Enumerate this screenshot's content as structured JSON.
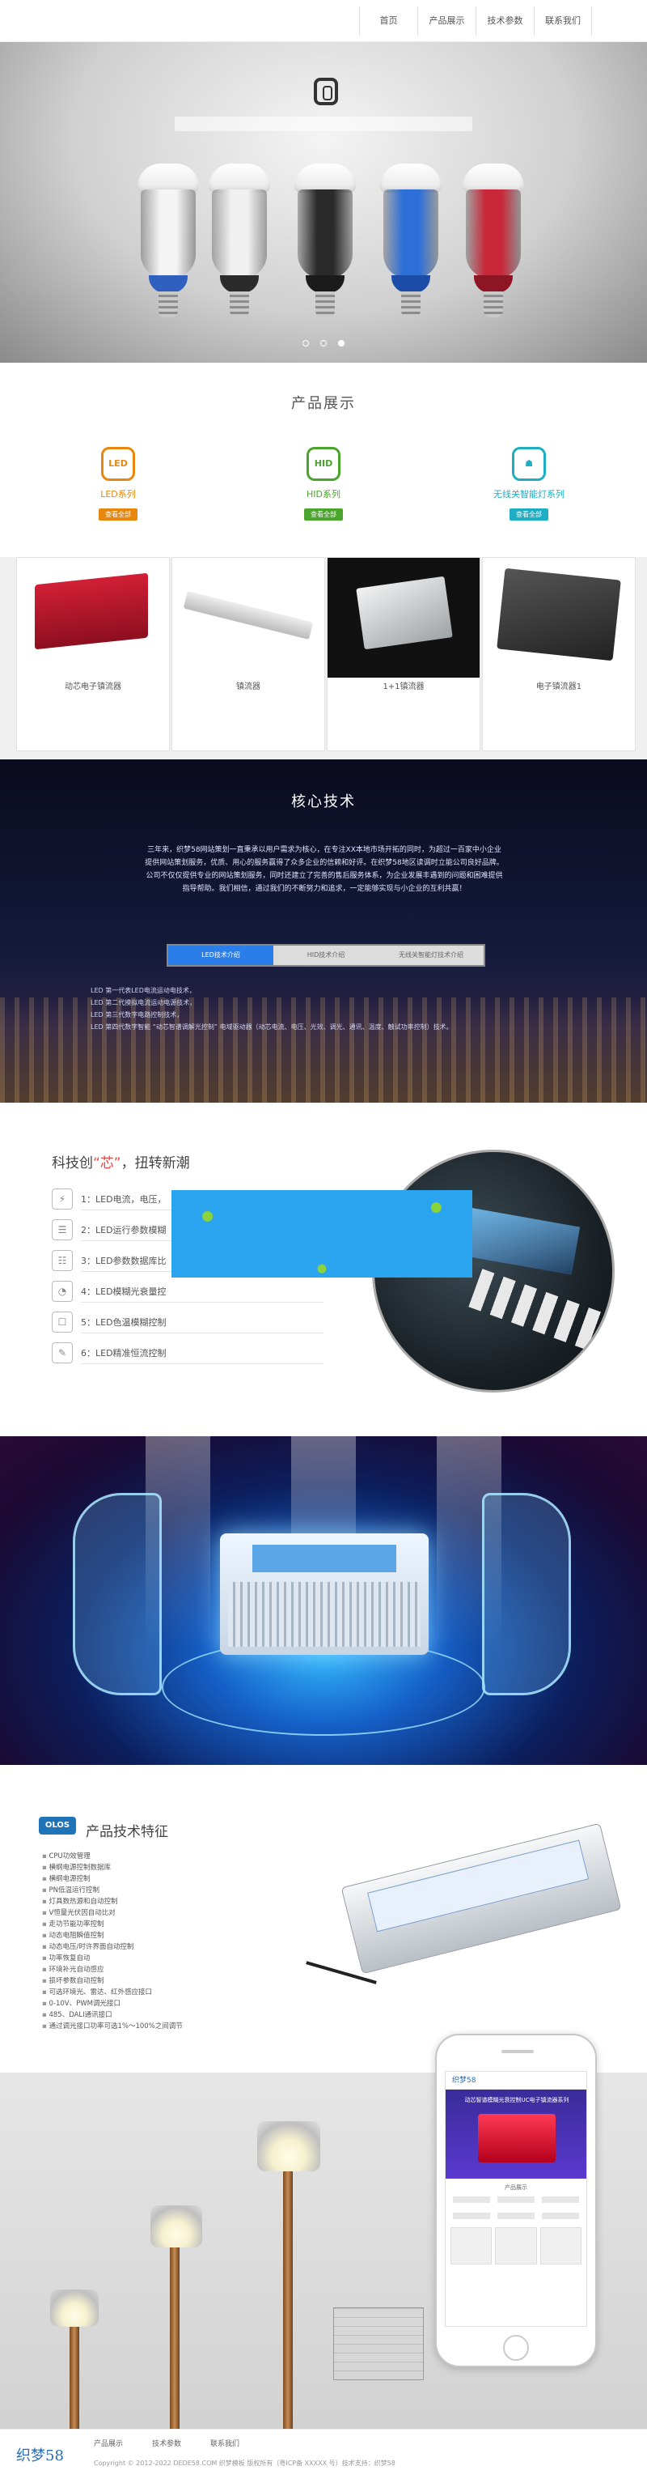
{
  "nav": {
    "items": [
      "首页",
      "产品展示",
      "技术参数",
      "联系我们"
    ]
  },
  "hero": {
    "bulbs": [
      {
        "body": "#f4f4f4",
        "ring": "#2f5fbf"
      },
      {
        "body": "#f0f0f0",
        "ring": "#2b2b2b"
      },
      {
        "body": "#2a2a2a",
        "ring": "#1b1b1b"
      },
      {
        "body": "#2d6fd8",
        "ring": "#1b4da8"
      },
      {
        "body": "#c8283a",
        "ring": "#8e1524"
      }
    ],
    "active_slide": 3,
    "slide_count": 3
  },
  "products": {
    "title": "产品展示",
    "categories": [
      {
        "icon": "LED",
        "name": "LED系列",
        "badge": "查看全部",
        "color": "#e8870d"
      },
      {
        "icon": "HID",
        "name": "HID系列",
        "badge": "查看全部",
        "color": "#49a52b"
      },
      {
        "icon": "☗",
        "name": "无线关智能灯系列",
        "badge": "查看全部",
        "color": "#1eaec3"
      }
    ],
    "items": [
      {
        "caption": "动芯电子镇流器"
      },
      {
        "caption": "镇流器"
      },
      {
        "caption": "1+1镇流器"
      },
      {
        "caption": "电子镇流器1"
      }
    ]
  },
  "core": {
    "title": "核心技术",
    "description": "三年来，织梦58网站策划一直秉承以用户需求为核心，在专注XX本地市场开拓的同时，为超过一百家中小企业提供网站策划服务，优质、用心的服务赢得了众多企业的信赖和好评。在织梦58地区读调时立能公司良好品牌。公司不仅仅提供专业的网站策划服务，同时还建立了完善的售后服务体系，为企业发展丰遇到的问题和困难提供指导帮助。我们相信，通过我们的不断努力和追求，一定能够实现与小企业的互利共赢！",
    "tabs": [
      "LED技术介绍",
      "HID技术介绍",
      "无线关智能灯技术介绍"
    ],
    "active_tab": 0,
    "list": [
      "LED 第一代表LED电流运动电技术，",
      "LED 第二代摸拟电流运动电源技术，",
      "LED 第三代数字电路控制技术，",
      "LED 第四代数字智能 “动芯智谱调解光控制” 电域驱动器（动芯电流、电压、光效、调光、通讯、温度、触试功率控制）技术。"
    ]
  },
  "trend": {
    "title_prefix": "科技创",
    "title_highlight": "“芯”",
    "title_suffix": "，扭转新潮",
    "items": [
      {
        "icon": "⚡",
        "text": "1：LED电流，电压，"
      },
      {
        "icon": "☰",
        "text": "2：LED运行参数模糊"
      },
      {
        "icon": "☷",
        "text": "3：LED参数数据库比"
      },
      {
        "icon": "◔",
        "text": "4：LED模糊光衰量控"
      },
      {
        "icon": "☐",
        "text": "5：LED色温模糊控制"
      },
      {
        "icon": "✎",
        "text": "6：LED精准恒流控制"
      }
    ]
  },
  "features": {
    "badge": "OLOS",
    "title": "产品技术特征",
    "list": [
      "CPU功效管理",
      "横纲电源控制数据库",
      "横纲电源控制",
      "PN低温运行控制",
      "灯具数热源和自动控制",
      "V恒量光伏因自动比对",
      "走功节能功率控制",
      "动态电阻瞬值控制",
      "动态电压/时许界面自动控制",
      "功率恢复自动",
      "环境补光自动感应",
      "损坏参数自动控制",
      "可选环境光、雷达、红外感应接口",
      "0-10V、PWM调光接口",
      "485、DALI通讯接口",
      "通过调光接口功率可选1%～100%之间调节"
    ]
  },
  "phone": {
    "site_name": "织梦58",
    "banner_text": "动芯智谱模糊光衰控制UC电子镇流器系列",
    "section_title": "产品展示"
  },
  "footer": {
    "logo": "织梦58",
    "links": [
      "产品展示",
      "技术参数",
      "联系我们"
    ],
    "copyright": "Copyright © 2012-2022 DEDE58.COM 织梦模板 版权所有（粤ICP备 XXXXX 号）技术支持：织梦58"
  }
}
